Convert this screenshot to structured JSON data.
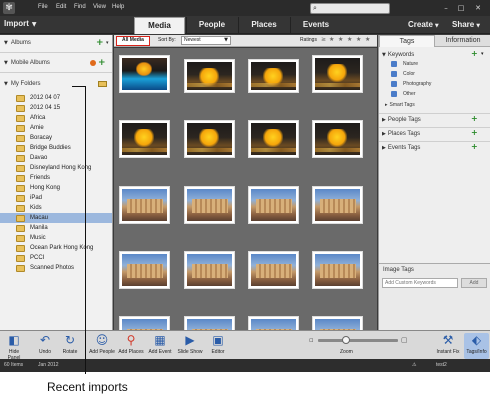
{
  "menubar": {
    "items": [
      "File",
      "Edit",
      "Find",
      "View",
      "Help"
    ],
    "search_placeholder": ""
  },
  "tabbar": {
    "import_label": "Import",
    "tabs": [
      "Media",
      "People",
      "Places",
      "Events"
    ],
    "active_tab": "Media",
    "create_label": "Create",
    "share_label": "Share"
  },
  "left_panel": {
    "albums_label": "Albums",
    "mobile_albums_label": "Mobile Albums",
    "my_folders_label": "My Folders",
    "folders": [
      "2012 04 07",
      "2012 04 15",
      "Africa",
      "Amie",
      "Boracay",
      "Bridge Buddies",
      "Davao",
      "Disneyland Hong Kong",
      "Friends",
      "Hong Kong",
      "iPad",
      "Kids",
      "Macau",
      "Manila",
      "Music",
      "Ocean Park Hong Kong",
      "PCCI",
      "Scanned Photos"
    ],
    "selected_folder": "Macau"
  },
  "media_toolbar": {
    "all_media_label": "All Media",
    "sort_by_label": "Sort By:",
    "sort_value": "Newest",
    "ratings_label": "Ratings",
    "rating_op": "≥"
  },
  "right_panel": {
    "tabs": [
      "Tags",
      "Information"
    ],
    "active_tab": "Tags",
    "keywords_label": "Keywords",
    "keyword_items": [
      "Nature",
      "Color",
      "Photography",
      "Other"
    ],
    "smart_tags_label": "Smart Tags",
    "people_tags_label": "People Tags",
    "places_tags_label": "Places Tags",
    "event_tags_label": "Events Tags",
    "image_tags_title": "Image Tags",
    "custom_keywords_placeholder": "Add Custom Keywords",
    "add_label": "Add"
  },
  "bottom_bar": {
    "tools": [
      {
        "label": "Hide Panel",
        "icon": "panel-icon"
      },
      {
        "label": "Undo",
        "icon": "undo-icon"
      },
      {
        "label": "Rotate",
        "icon": "rotate-icon"
      },
      {
        "label": "Add People",
        "icon": "add-people-icon"
      },
      {
        "label": "Add Places",
        "icon": "add-places-icon"
      },
      {
        "label": "Add Event",
        "icon": "add-event-icon"
      },
      {
        "label": "Slide Show",
        "icon": "play-icon"
      },
      {
        "label": "Editor",
        "icon": "editor-icon"
      },
      {
        "label": "Instant Fix",
        "icon": "instant-fix-icon"
      },
      {
        "label": "Tags/Info",
        "icon": "tag-icon"
      }
    ],
    "zoom_label": "Zoom",
    "zoom_level": 0.33
  },
  "status_bar": {
    "items_count": "60 Items",
    "date": "Jan 2012",
    "catalog": "test2"
  },
  "callout": {
    "text": "Recent imports"
  },
  "colors": {
    "accent": "#d8231a",
    "selection": "#9cb8de",
    "add_green": "#2a8a2a",
    "folder_yellow": "#e8c05a"
  }
}
